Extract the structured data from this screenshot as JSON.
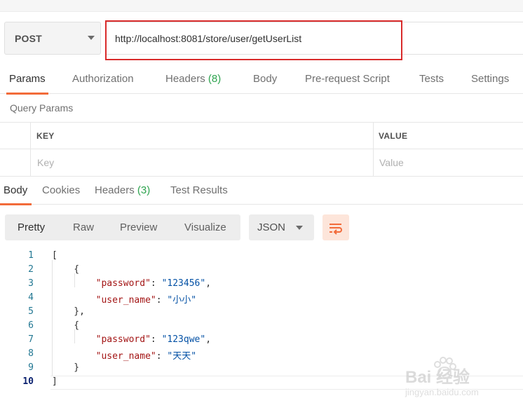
{
  "request": {
    "method": "POST",
    "url": "http://localhost:8081/store/user/getUserList"
  },
  "request_tabs": [
    {
      "label": "Params",
      "count": ""
    },
    {
      "label": "Authorization",
      "count": ""
    },
    {
      "label": "Headers ",
      "count": "(8)"
    },
    {
      "label": "Body",
      "count": ""
    },
    {
      "label": "Pre-request Script",
      "count": ""
    },
    {
      "label": "Tests",
      "count": ""
    },
    {
      "label": "Settings",
      "count": ""
    }
  ],
  "query_params": {
    "title": "Query Params",
    "key_header": "KEY",
    "value_header": "VALUE",
    "key_placeholder": "Key",
    "value_placeholder": "Value"
  },
  "response_tabs": [
    {
      "label": "Body",
      "count": ""
    },
    {
      "label": "Cookies",
      "count": ""
    },
    {
      "label": "Headers ",
      "count": "(3)"
    },
    {
      "label": "Test Results",
      "count": ""
    }
  ],
  "format_buttons": [
    "Pretty",
    "Raw",
    "Preview",
    "Visualize"
  ],
  "language": "JSON",
  "code": {
    "line_numbers": [
      "1",
      "2",
      "3",
      "4",
      "5",
      "6",
      "7",
      "8",
      "9",
      "10"
    ],
    "lines": [
      [
        {
          "t": "p",
          "v": "["
        }
      ],
      [
        {
          "t": "p",
          "v": "    {"
        }
      ],
      [
        {
          "t": "p",
          "v": "        "
        },
        {
          "t": "k",
          "v": "\"password\""
        },
        {
          "t": "p",
          "v": ": "
        },
        {
          "t": "s",
          "v": "\"123456\""
        },
        {
          "t": "p",
          "v": ","
        }
      ],
      [
        {
          "t": "p",
          "v": "        "
        },
        {
          "t": "k",
          "v": "\"user_name\""
        },
        {
          "t": "p",
          "v": ": "
        },
        {
          "t": "s",
          "v": "\"小小\""
        }
      ],
      [
        {
          "t": "p",
          "v": "    },"
        }
      ],
      [
        {
          "t": "p",
          "v": "    {"
        }
      ],
      [
        {
          "t": "p",
          "v": "        "
        },
        {
          "t": "k",
          "v": "\"password\""
        },
        {
          "t": "p",
          "v": ": "
        },
        {
          "t": "s",
          "v": "\"123qwe\""
        },
        {
          "t": "p",
          "v": ","
        }
      ],
      [
        {
          "t": "p",
          "v": "        "
        },
        {
          "t": "k",
          "v": "\"user_name\""
        },
        {
          "t": "p",
          "v": ": "
        },
        {
          "t": "s",
          "v": "\"天天\""
        }
      ],
      [
        {
          "t": "p",
          "v": "    }"
        }
      ],
      [
        {
          "t": "p",
          "v": "]"
        }
      ]
    ]
  },
  "watermark": {
    "text": "Bai 经验",
    "sub": "jingyan.baidu.com"
  },
  "colors": {
    "accent": "#f26b3a",
    "count_green": "#2ea44f",
    "highlight_red": "#d92b2b",
    "json_key": "#a31515",
    "json_string": "#0451a5"
  }
}
